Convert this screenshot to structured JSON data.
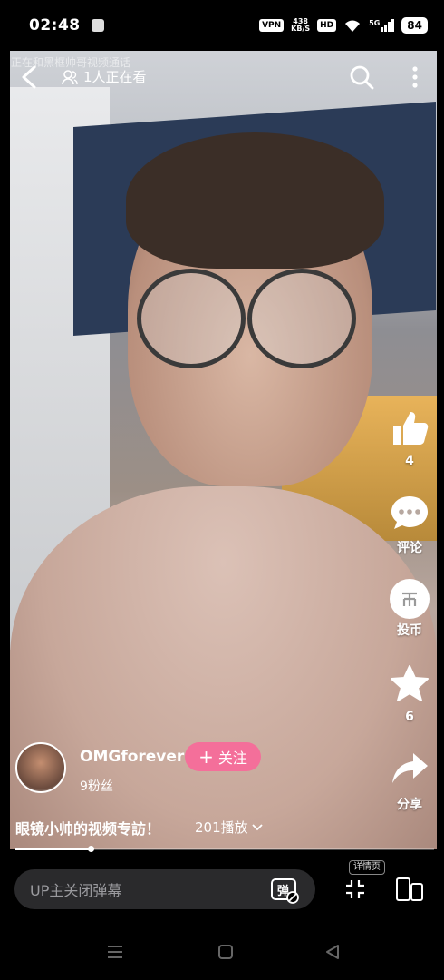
{
  "status_bar": {
    "time": "02:48",
    "vpn": "VPN",
    "speed_top": "438",
    "speed_bottom": "KB/S",
    "hd": "HD",
    "signal": "5G",
    "battery": "84"
  },
  "top_overlay": {
    "watermark": "正在和黑框帅哥视频通话",
    "viewers": "1人正在看"
  },
  "actions": {
    "like_count": "4",
    "comment_label": "评论",
    "coin_label": "投币",
    "favorite_count": "6",
    "share_label": "分享"
  },
  "author": {
    "name": "OMGforever",
    "follow_label": "关注",
    "fans": "9粉丝"
  },
  "video": {
    "title": "眼镜小帅的视频专訪！",
    "plays": "201播放",
    "progress": 0.18
  },
  "bottom_bar": {
    "danmaku_placeholder": "UP主关闭弹幕",
    "danmaku_icon_text": "弹",
    "detail_label": "详情页"
  },
  "icons": [
    "back-icon",
    "viewers-icon",
    "search-icon",
    "more-icon",
    "like-icon",
    "comment-icon",
    "coin-icon",
    "favorite-icon",
    "share-icon",
    "chevron-down-icon",
    "danmaku-icon",
    "exit-fullscreen-icon",
    "rotate-icon",
    "menu-icon",
    "home-icon",
    "back-nav-icon"
  ],
  "colors": {
    "follow": "#f46f9a",
    "input_bg": "#2a2a2c"
  }
}
